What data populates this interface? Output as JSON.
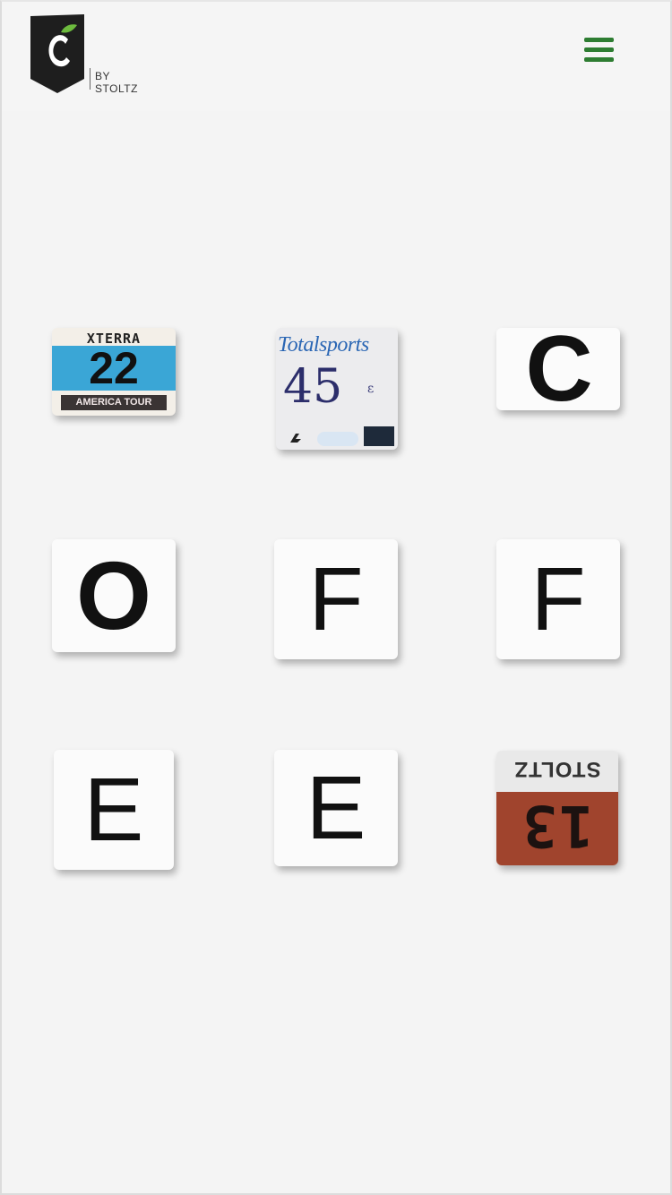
{
  "header": {
    "logo_text": "BY STOLTZ",
    "logo_letter": "C",
    "brand_colors": {
      "accent_green": "#2e7d32",
      "leaf_green": "#6dbb3e",
      "shield": "#1e1e1e"
    },
    "menu_icon": "hamburger-menu-icon"
  },
  "tiles": [
    {
      "kind": "race-bib",
      "brand": "XTERRA",
      "number": "22",
      "caption": "AMERICA TOUR"
    },
    {
      "kind": "race-bib",
      "brand": "Totalsports",
      "number": "45",
      "mark": "ε"
    },
    {
      "kind": "letter",
      "letter": "C"
    },
    {
      "kind": "letter",
      "letter": "O"
    },
    {
      "kind": "letter",
      "letter": "F"
    },
    {
      "kind": "letter",
      "letter": "F"
    },
    {
      "kind": "letter",
      "letter": "E"
    },
    {
      "kind": "letter",
      "letter": "E"
    },
    {
      "kind": "race-bib",
      "brand": "STOLTZ",
      "number": "13",
      "rotated": "upside-down"
    }
  ]
}
